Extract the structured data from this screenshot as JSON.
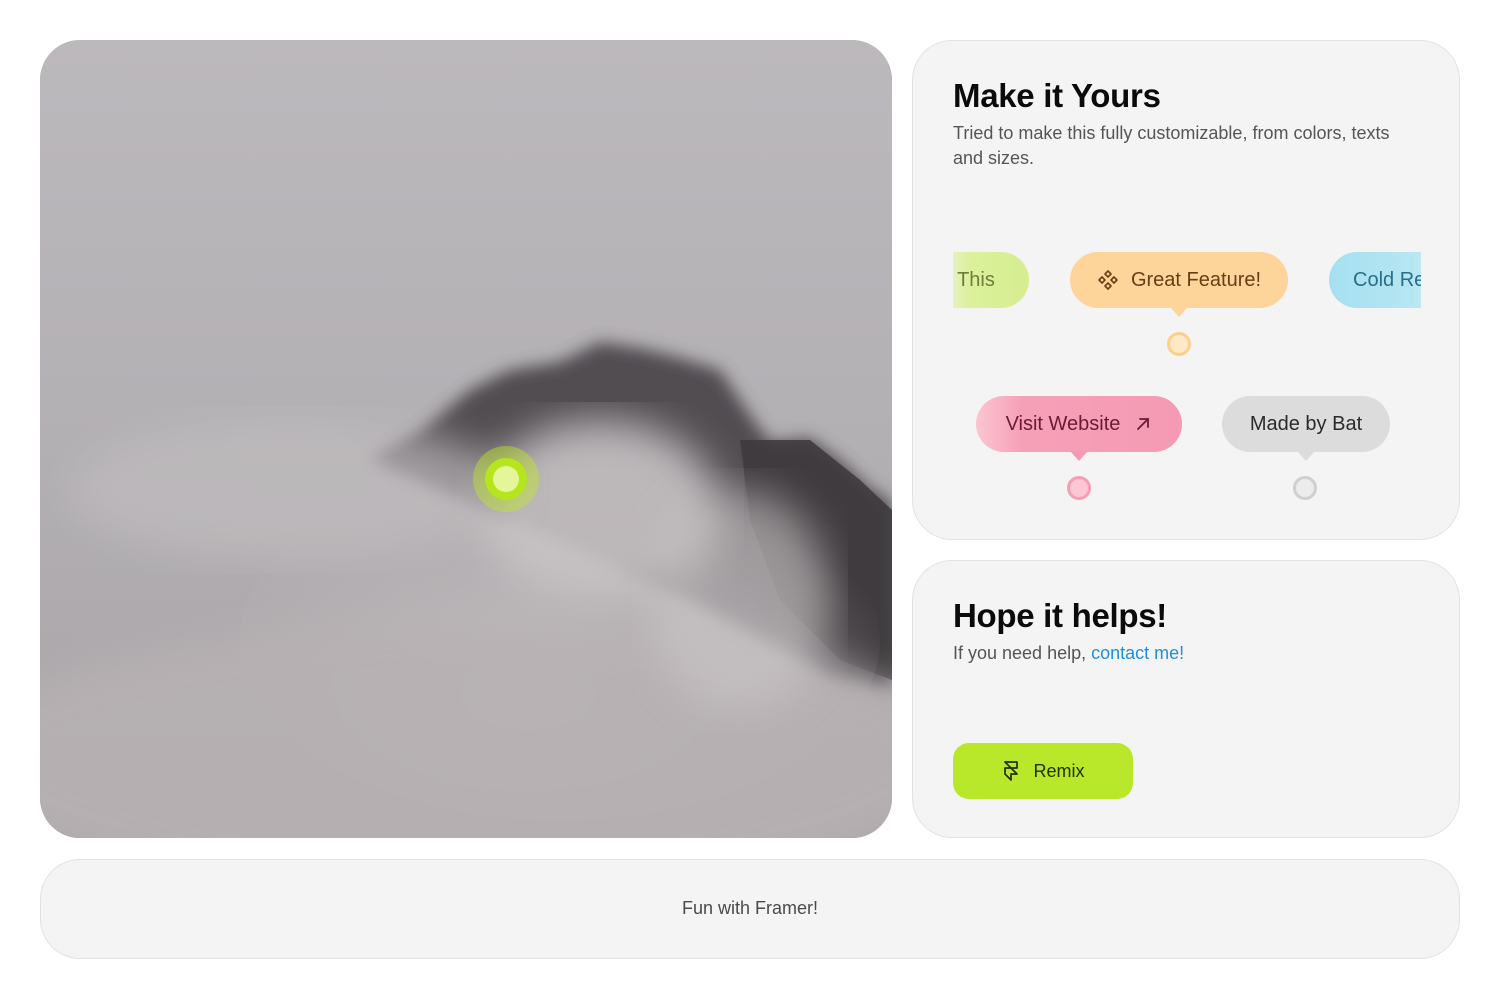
{
  "photo": {
    "alt_subject": "mountain-in-clouds",
    "hotspot_color": "#b5e61d"
  },
  "customize_card": {
    "title": "Make it Yours",
    "description": "Tried to make this fully customizable, from colors, texts and sizes.",
    "pills": {
      "this": {
        "label": "This",
        "color": "#dcf09b"
      },
      "great_feature": {
        "label": "Great Feature!",
        "icon": "framer-component-icon",
        "color": "#fdd49a"
      },
      "cold": {
        "label": "Cold Re",
        "color": "#a6e0f0"
      },
      "visit_website": {
        "label": "Visit Website",
        "icon": "arrow-up-right-icon",
        "color": "#f59ab4"
      },
      "made_by": {
        "label": "Made by Bat",
        "color": "#dcdcdc"
      }
    }
  },
  "help_card": {
    "title": "Hope it helps!",
    "description_prefix": "If you need help, ",
    "contact_link": "contact me!",
    "link_color": "#1d8fe0",
    "remix_label": "Remix",
    "remix_icon": "framer-logo-icon",
    "remix_color": "#b9e82a"
  },
  "footer": {
    "text": "Fun with Framer!"
  }
}
